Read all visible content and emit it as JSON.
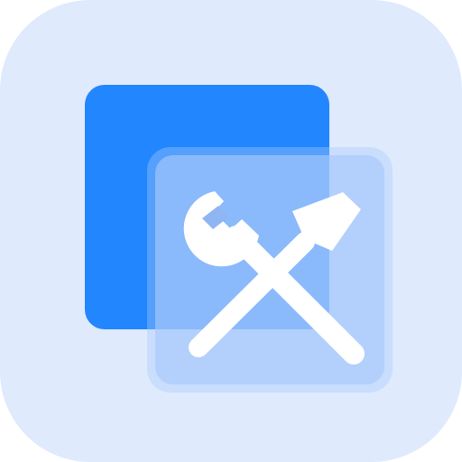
{
  "icon": {
    "name": "tools-app-icon",
    "symbol": "wrench-and-screwdriver-icon",
    "colors": {
      "background": "#dfeafd",
      "back_square": "#2286ff",
      "front_glass": "#a8c8fb",
      "front_glass_opacity": 0.65,
      "glyph": "#ffffff"
    }
  }
}
